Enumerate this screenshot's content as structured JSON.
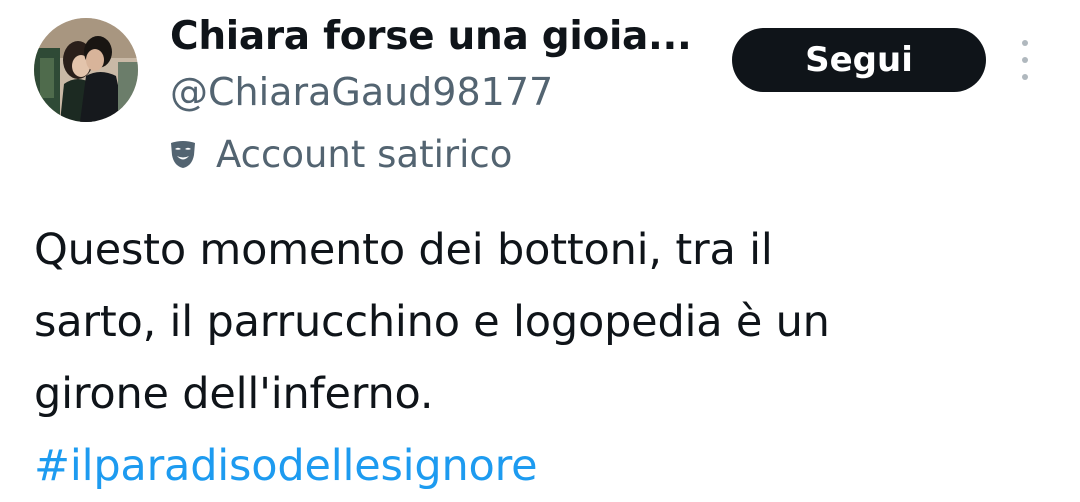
{
  "author": {
    "display_name": "Chiara forse una gioia...",
    "handle": "@ChiaraGaud98177",
    "label_icon": "theater-mask-icon",
    "label_text": "Account satirico"
  },
  "actions": {
    "follow_label": "Segui",
    "more_icon": "vertical-dots-icon"
  },
  "tweet": {
    "text_lines": [
      "Questo momento dei bottoni, tra il",
      "sarto, il parrucchino e logopedia è un",
      "girone dell'inferno."
    ],
    "hashtag": "#ilparadisodellesignore"
  },
  "colors": {
    "text": "#0f1419",
    "secondary": "#536471",
    "link": "#1d9bf0",
    "button_bg": "#0f1419",
    "button_text": "#ffffff"
  }
}
